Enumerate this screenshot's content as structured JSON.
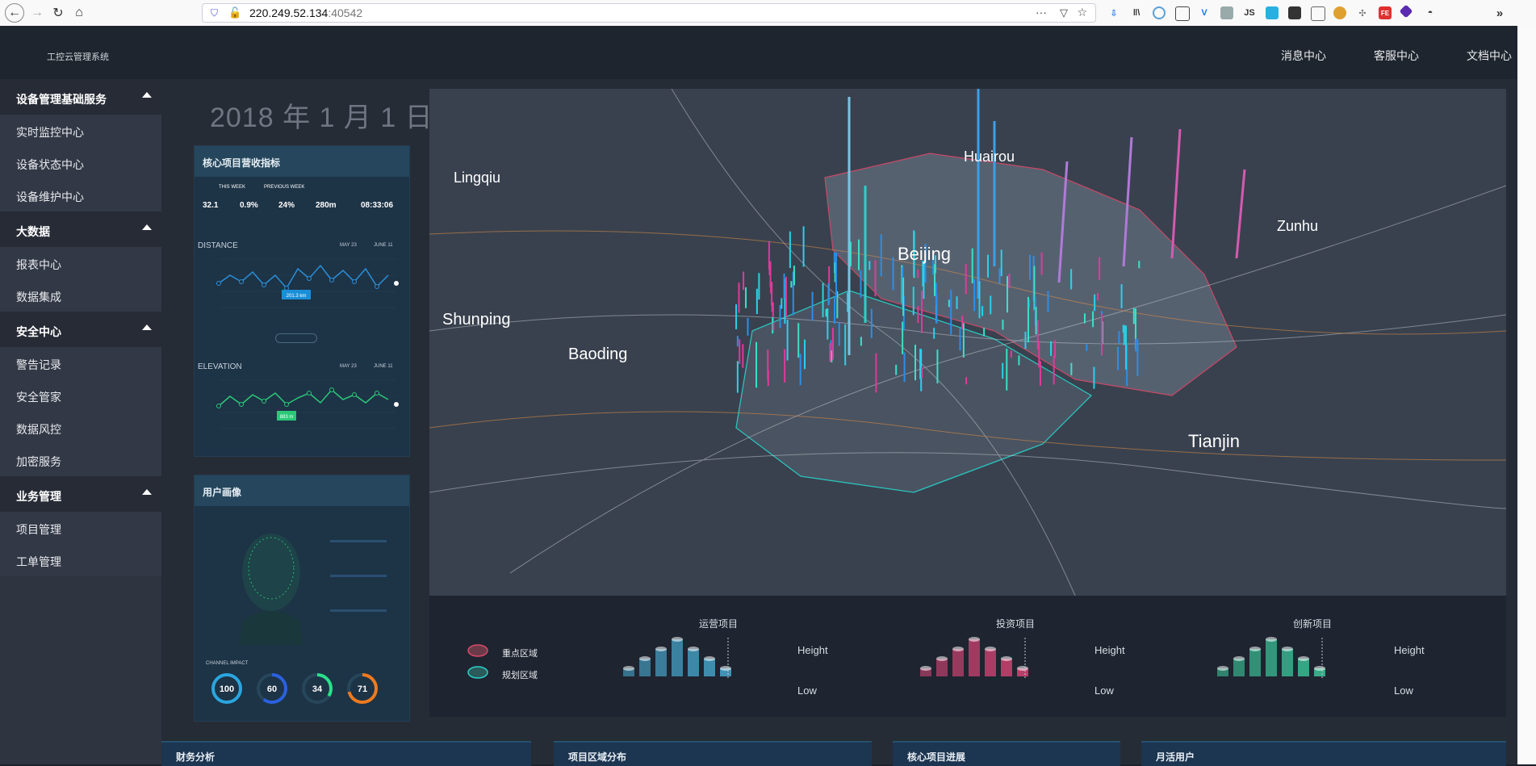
{
  "browser": {
    "url_host": "220.249.52.134",
    "url_port": ":40542"
  },
  "app": {
    "title": "工控云管理系统",
    "top_nav": [
      "消息中心",
      "客服中心",
      "文档中心"
    ]
  },
  "sidebar": {
    "groups": [
      {
        "label": "设备管理基础服务",
        "items": [
          "实时监控中心",
          "设备状态中心",
          "设备维护中心"
        ]
      },
      {
        "label": "大数据",
        "items": [
          "报表中心",
          "数据集成"
        ]
      },
      {
        "label": "安全中心",
        "items": [
          "警告记录",
          "安全管家",
          "数据风控",
          "加密服务"
        ]
      },
      {
        "label": "业务管理",
        "items": [
          "项目管理",
          "工单管理"
        ]
      }
    ]
  },
  "dashboard": {
    "date": "2018 年 1 月 1 日",
    "revenue_card": {
      "title": "核心项目营收指标",
      "range_this": "THIS WEEK",
      "range_prev": "PREVIOUS WEEK",
      "kpis": [
        "32.1",
        "0.9%",
        "24%",
        "280m",
        "08:33:06"
      ],
      "distance": {
        "label": "DISTANCE",
        "from": "MAY 23",
        "to": "JUNE 11",
        "tooltip": "201.3 km"
      },
      "elevation": {
        "label": "ELEVATION",
        "from": "MAY 23",
        "to": "JUNE 11",
        "tooltip": "883 m"
      }
    },
    "user_card": {
      "title": "用户画像",
      "channel_label": "CHANNEL IMPACT",
      "rings": [
        {
          "value": "100",
          "color": "#2aa6e0",
          "level": 1.0
        },
        {
          "value": "60",
          "color": "#2a61e0",
          "level": 0.6
        },
        {
          "value": "34",
          "color": "#2ae08a",
          "level": 0.34
        },
        {
          "value": "71",
          "color": "#f07a1e",
          "level": 0.71
        }
      ]
    },
    "map": {
      "cities": [
        "Lingqiu",
        "Huairou",
        "Beijing",
        "Zunhu",
        "Shunping",
        "Baoding",
        "Tianjin"
      ]
    },
    "legend": {
      "areas": [
        {
          "label": "重点区域",
          "color": "#d94a6a"
        },
        {
          "label": "规划区域",
          "color": "#2ad1c8"
        }
      ],
      "groups": [
        {
          "title": "运营项目",
          "high": "Height",
          "low": "Low",
          "color": "#4ab0d8"
        },
        {
          "title": "投资项目",
          "high": "Height",
          "low": "Low",
          "color": "#e0487a"
        },
        {
          "title": "创新项目",
          "high": "Height",
          "low": "Low",
          "color": "#3ed0a0"
        }
      ]
    },
    "bottom_cards": [
      "财务分析",
      "项目区域分布",
      "核心项目进展",
      "月活用户"
    ]
  }
}
